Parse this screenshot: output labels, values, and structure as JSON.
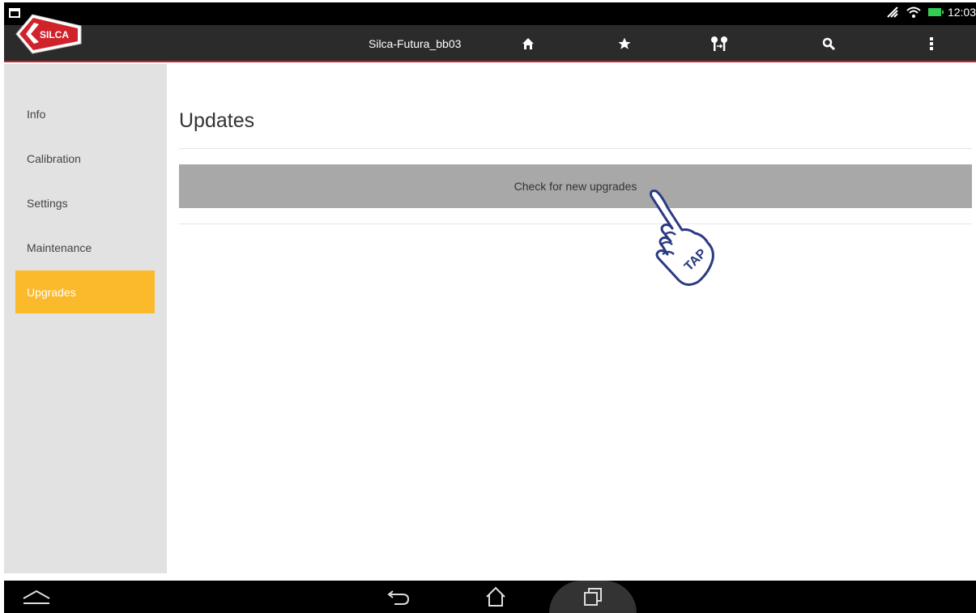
{
  "status_bar": {
    "time": "12:03"
  },
  "app_bar": {
    "title": "Silca-Futura_bb03",
    "logo_text": "SILCA",
    "icons": [
      "home-icon",
      "star-icon",
      "keys-icon",
      "search-icon",
      "overflow-menu-icon"
    ],
    "accent_color": "#d0222a"
  },
  "sidebar": {
    "items": [
      {
        "label": "Info"
      },
      {
        "label": "Calibration"
      },
      {
        "label": "Settings"
      },
      {
        "label": "Maintenance"
      },
      {
        "label": "Upgrades",
        "active": true
      }
    ],
    "active_color": "#fbb92c"
  },
  "main": {
    "title": "Updates",
    "check_button_label": "Check for new upgrades",
    "tap_hint": "TAP"
  },
  "system_nav": {
    "buttons": [
      "up-chevron-icon",
      "back-icon",
      "home-outline-icon",
      "recents-icon"
    ]
  }
}
